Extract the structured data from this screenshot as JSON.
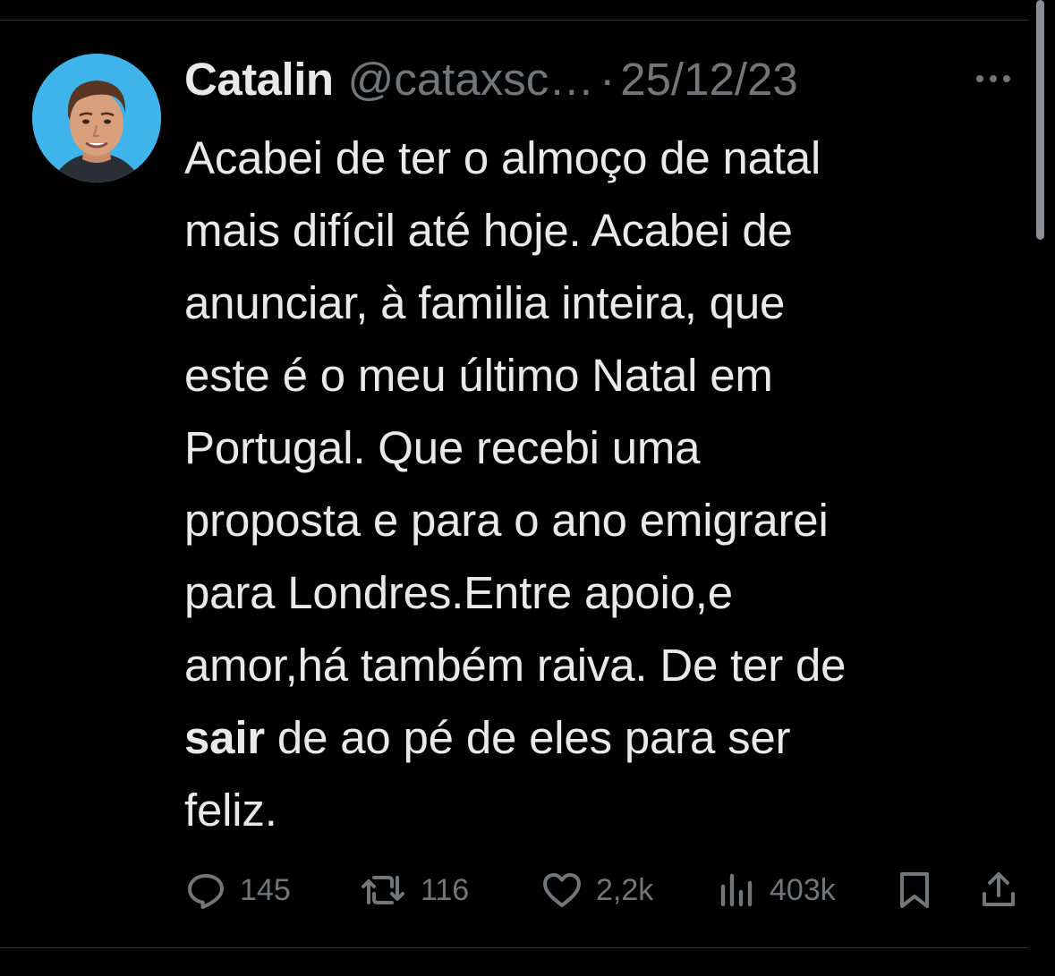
{
  "tweet": {
    "author": {
      "display_name": "Catalin",
      "handle": "@cataxsc…",
      "avatar_icon": "profile-photo"
    },
    "separator": "·",
    "date": "25/12/23",
    "more_icon": "ellipsis-icon",
    "text_lines": [
      "Acabei de ter o almoço de natal",
      "mais difícil até hoje. Acabei de",
      "anunciar, à familia inteira, que",
      "este é o meu último Natal em",
      "Portugal. Que recebi uma",
      "proposta e para o ano emigrarei",
      "para Londres.Entre apoio,e",
      "amor,há também raiva. De ter de"
    ],
    "line_9_bold": "sair",
    "line_9_rest": " de ao pé de eles para ser",
    "line_10": "feliz.",
    "actions": {
      "replies": {
        "icon": "reply-icon",
        "count": "145"
      },
      "retweets": {
        "icon": "retweet-icon",
        "count": "116"
      },
      "likes": {
        "icon": "heart-icon",
        "count": "2,2k"
      },
      "views": {
        "icon": "views-icon",
        "count": "403k"
      },
      "bookmark": {
        "icon": "bookmark-icon"
      },
      "share": {
        "icon": "share-icon"
      }
    }
  },
  "colors": {
    "background": "#000000",
    "text_primary": "#e7e9ea",
    "text_secondary": "#71767b",
    "avatar_bg": "#3eb4ea"
  }
}
